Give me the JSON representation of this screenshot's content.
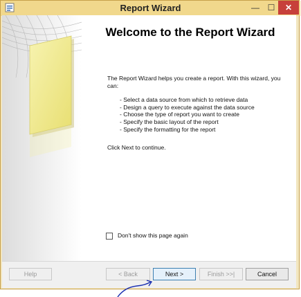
{
  "window": {
    "title": "Report Wizard",
    "controls": {
      "minimize": "—",
      "maximize": "☐",
      "close": "✕"
    }
  },
  "main": {
    "heading": "Welcome to the Report Wizard",
    "intro": "The Report Wizard helps you create a report. With this wizard, you can:",
    "steps": [
      "- Select a data source from which to retrieve data",
      "- Design a query to execute against the data source",
      "- Choose the type of report you want to create",
      "- Specify the basic layout of the report",
      "- Specify the formatting for the report"
    ],
    "continue_text": "Click Next to continue.",
    "checkbox_label": "Don't show this page again",
    "checkbox_checked": false
  },
  "footer": {
    "help": "Help",
    "back": "< Back",
    "next": "Next >",
    "finish": "Finish >>|",
    "cancel": "Cancel"
  },
  "colors": {
    "titlebar": "#f1d88c",
    "close_button": "#c7403a",
    "banner_doc": "#f4ef9a",
    "annotation_arrow": "#1a2fb0"
  }
}
